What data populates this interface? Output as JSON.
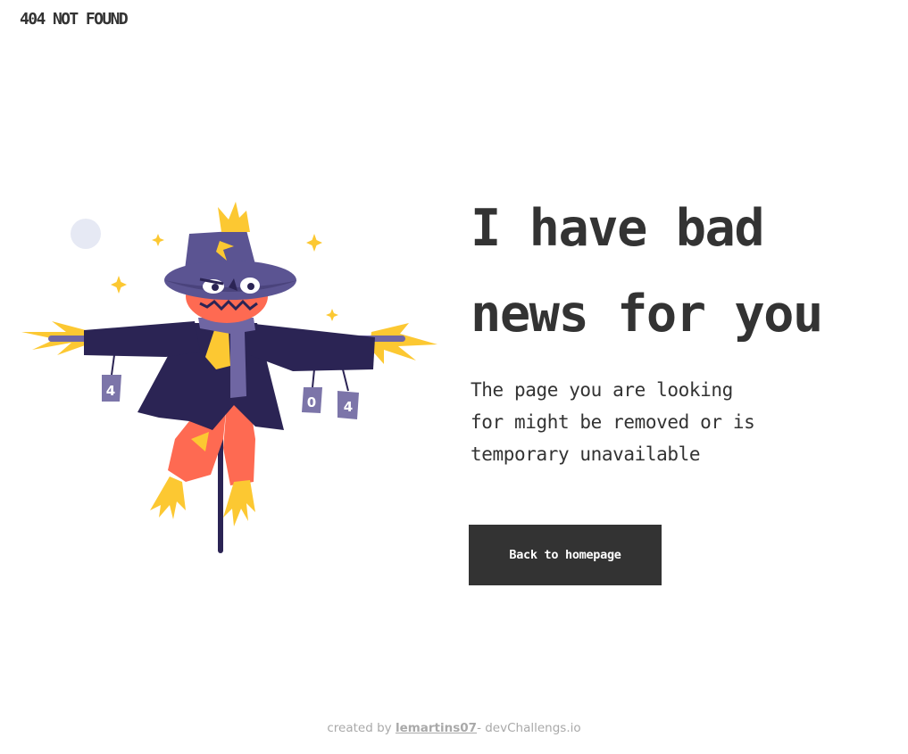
{
  "header": {
    "brand": "404 NOT FOUND"
  },
  "hero": {
    "headline_line1": "I have bad",
    "headline_line2": "news for you",
    "subtext_line1": "The page you are looking",
    "subtext_line2": "for might be removed or is",
    "subtext_line3": "temporary unavailable",
    "button_label": "Back to homepage"
  },
  "illustration": {
    "subject": "scarecrow",
    "can_labels": [
      "4",
      "0",
      "4"
    ],
    "colors": {
      "hat": "#5b5492",
      "coat": "#2b2454",
      "pumpkin": "#fe6a52",
      "straw": "#fcc832",
      "scarf": "#6f66a3",
      "cans": "#7c75a9",
      "moon": "#e6e9f4",
      "pole": "#2b2454"
    }
  },
  "footer": {
    "prefix": "created by ",
    "author": "lemartins07",
    "suffix": "- devChallengs.io"
  },
  "colors": {
    "text": "#333333",
    "button_bg": "#333333",
    "button_text": "#ffffff",
    "footer_text": "#a9a9a9",
    "background": "#ffffff"
  }
}
